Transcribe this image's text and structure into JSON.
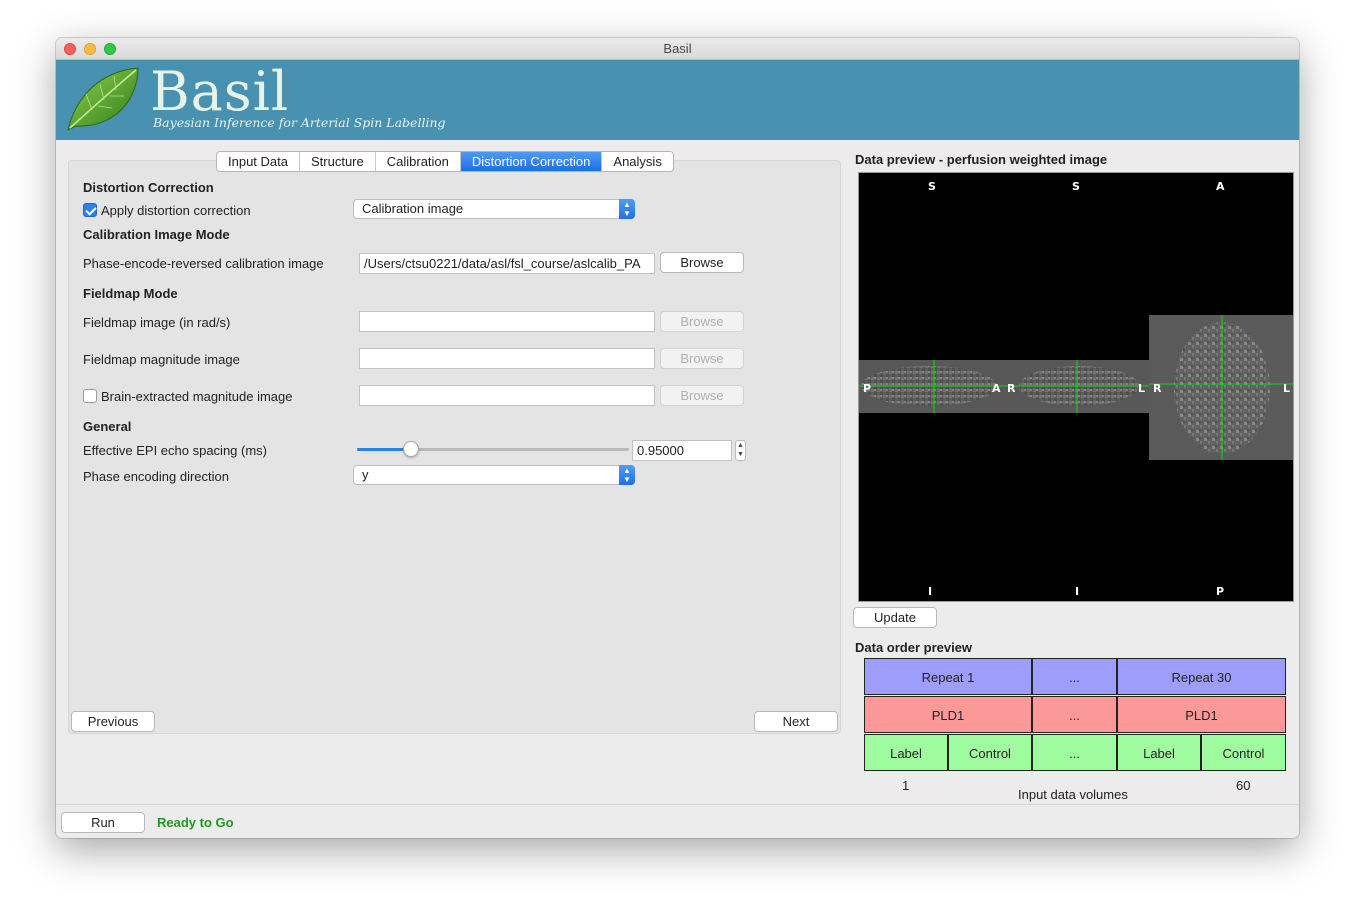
{
  "window": {
    "title": "Basil"
  },
  "banner": {
    "title": "Basil",
    "subtitle": "Bayesian Inference for Arterial Spin Labelling"
  },
  "tabs": [
    {
      "label": "Input Data"
    },
    {
      "label": "Structure"
    },
    {
      "label": "Calibration"
    },
    {
      "label": "Distortion Correction",
      "active": true
    },
    {
      "label": "Analysis"
    }
  ],
  "distortion": {
    "heading": "Distortion Correction",
    "apply_label": "Apply distortion correction",
    "apply_checked": true,
    "mode_selected": "Calibration image"
  },
  "calib_mode": {
    "heading": "Calibration Image Mode",
    "pe_label": "Phase-encode-reversed calibration image",
    "pe_value": "/Users/ctsu0221/data/asl/fsl_course/aslcalib_PA",
    "browse": "Browse"
  },
  "fieldmap": {
    "heading": "Fieldmap Mode",
    "image_label": "Fieldmap image (in rad/s)",
    "image_value": "",
    "mag_label": "Fieldmap magnitude image",
    "mag_value": "",
    "brain_label": "Brain-extracted magnitude image",
    "brain_checked": false,
    "brain_value": "",
    "browse": "Browse"
  },
  "general": {
    "heading": "General",
    "echo_label": "Effective EPI echo spacing (ms)",
    "echo_value": "0.95000",
    "echo_slider_fraction": 0.2,
    "pe_dir_label": "Phase encoding direction",
    "pe_dir_value": "y"
  },
  "nav": {
    "previous": "Previous",
    "next": "Next"
  },
  "preview": {
    "title": "Data preview - perfusion weighted image",
    "update": "Update",
    "orient": {
      "top": [
        "S",
        "S",
        "A"
      ],
      "bottom": [
        "I",
        "I",
        "P"
      ],
      "mid": [
        "P",
        "A",
        "R",
        "L",
        "R",
        "L"
      ]
    }
  },
  "data_order": {
    "title": "Data order preview",
    "repeat_first": "Repeat 1",
    "ellipsis": "...",
    "repeat_last": "Repeat 30",
    "pld": "PLD1",
    "label": "Label",
    "control": "Control",
    "vol_first": "1",
    "vol_last": "60",
    "axis_label": "Input data volumes"
  },
  "status": {
    "run": "Run",
    "message": "Ready to Go"
  },
  "colors": {
    "banner": "#4891b0",
    "tab_active": "#1d6fe8",
    "repeat": "#9d9dfb",
    "pld": "#fb9898",
    "label_control": "#9efc9e",
    "status_ok": "#1e9a1e",
    "crosshair": "#00e000"
  }
}
